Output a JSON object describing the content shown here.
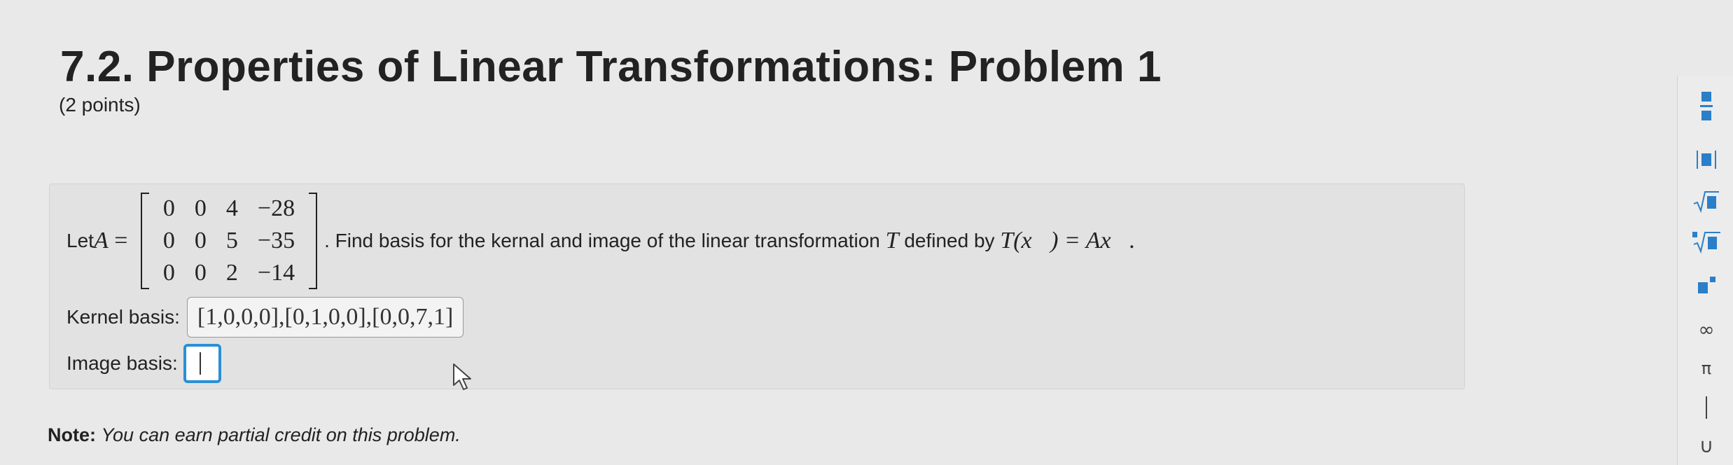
{
  "header": {
    "title": "7.2. Properties of Linear Transformations: Problem 1",
    "points": "(2 points)"
  },
  "problem": {
    "let_text": "Let ",
    "var_A": "A",
    "equals": " = ",
    "matrix": [
      [
        "0",
        "0",
        "4",
        "−28"
      ],
      [
        "0",
        "0",
        "5",
        "−35"
      ],
      [
        "0",
        "0",
        "2",
        "−14"
      ]
    ],
    "find_text": ". Find basis for the kernal and image of the linear transformation ",
    "var_T": "T",
    "defined_by": " defined by ",
    "formula": "T(x⃗) = Ax⃗.",
    "kernel_label": "Kernel basis:",
    "kernel_value": "[1,0,0,0],[0,1,0,0],[0,0,7,1]",
    "image_label": "Image basis:",
    "image_value": ""
  },
  "note": {
    "label": "Note:",
    "text": "You can earn partial credit on this problem."
  },
  "toolbar": {
    "items": [
      "fraction-icon",
      "absolute-value-icon",
      "sqrt-icon",
      "nth-root-icon",
      "exponent-icon",
      "infinity-icon",
      "pi-icon",
      "vertical-bar-icon",
      "union-icon"
    ],
    "infinity": "∞",
    "pi": "π",
    "union": "∪"
  },
  "colors": {
    "accent": "#2a8fd6",
    "background": "#e9e9e9"
  }
}
